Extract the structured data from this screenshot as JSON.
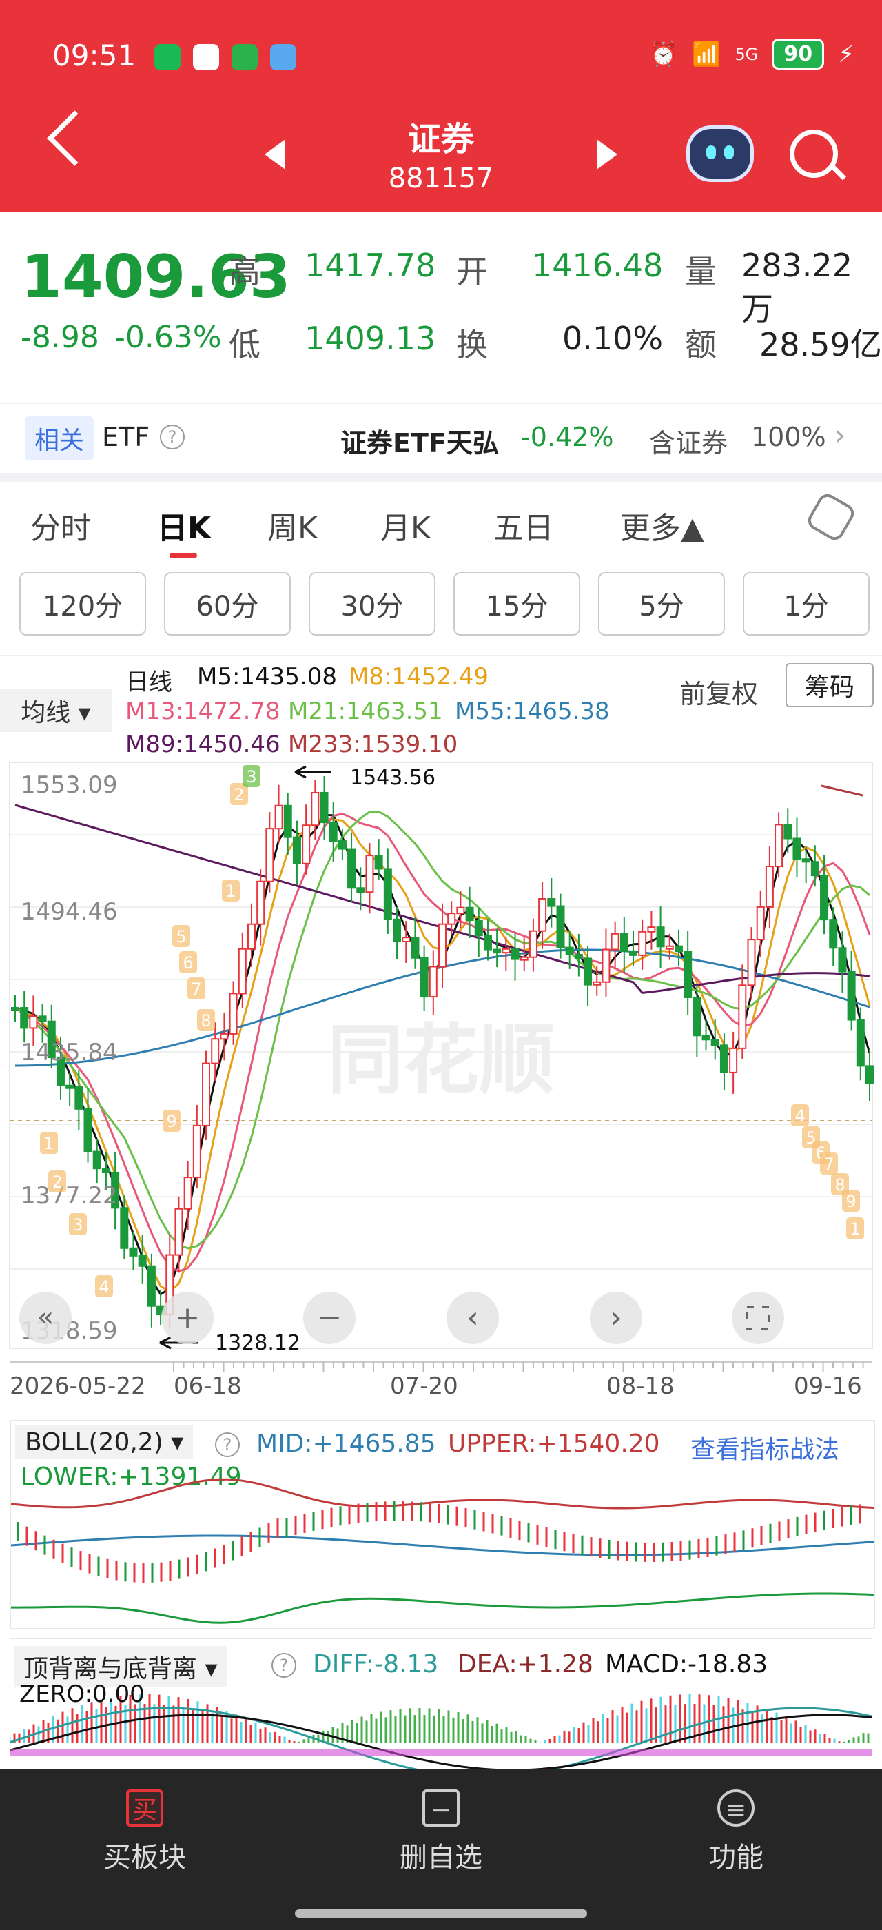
{
  "status": {
    "time": "09:51",
    "signal": "5G",
    "battery": "90"
  },
  "header": {
    "title": "证券",
    "code": "881157"
  },
  "quote": {
    "price": "1409.63",
    "change": "-8.98",
    "change_pct": "-0.63%",
    "high_label": "高",
    "high": "1417.78",
    "low_label": "低",
    "low": "1409.13",
    "open_label": "开",
    "open": "1416.48",
    "turnover_label": "换",
    "turnover": "0.10%",
    "volume_label": "量",
    "volume": "283.22万",
    "amount_label": "额",
    "amount": "28.59亿"
  },
  "etf": {
    "tag": "相关",
    "label": "ETF",
    "name": "证券ETF天弘",
    "change": "-0.42%",
    "contain_label": "含证券",
    "contain": "100%"
  },
  "tabs": [
    "分时",
    "日K",
    "周K",
    "月K",
    "五日",
    "更多▲"
  ],
  "periods": [
    "120分",
    "60分",
    "30分",
    "15分",
    "5分",
    "1分"
  ],
  "ma": {
    "selector": "均线 ▾",
    "line_label": "日线",
    "m5": "M5:1435.08",
    "m8": "M8:1452.49",
    "m13": "M13:1472.78",
    "m21": "M21:1463.51",
    "m55": "M55:1465.38",
    "m89": "M89:1450.46",
    "m233": "M233:1539.10",
    "adjust": "前复权",
    "chips": "筹码"
  },
  "colors": {
    "up": "#e9333b",
    "down": "#1a9a3a",
    "m5": "#111111",
    "m8": "#e6a117",
    "m13": "#e8587a",
    "m21": "#6cc04a",
    "m55": "#2e7fb0",
    "m89": "#5c1a5e",
    "m233": "#b03a3a"
  },
  "kchart": {
    "y_labels": [
      "1553.09",
      "1494.46",
      "1435.84",
      "1377.22",
      "1318.59"
    ],
    "x_labels": [
      "2026-05-22",
      "06-18",
      "07-20",
      "08-18",
      "09-16"
    ],
    "max_label": "1543.56",
    "min_label": "1328.12",
    "seq_markers": [
      "1",
      "2",
      "3",
      "4",
      "5",
      "6",
      "7",
      "8",
      "9"
    ]
  },
  "boll": {
    "selector": "BOLL(20,2) ▾",
    "mid": "MID:+1465.85",
    "upper": "UPPER:+1540.20",
    "lower": "LOWER:+1391.49",
    "link": "查看指标战法"
  },
  "macd": {
    "selector": "顶背离与底背离 ▾",
    "diff": "DIFF:-8.13",
    "dea": "DEA:+1.28",
    "macd": "MACD:-18.83",
    "zero": "ZERO:0.00"
  },
  "bottom": [
    {
      "icon": "买",
      "label": "买板块"
    },
    {
      "icon": "−",
      "label": "删自选"
    },
    {
      "icon": "≡",
      "label": "功能"
    }
  ]
}
